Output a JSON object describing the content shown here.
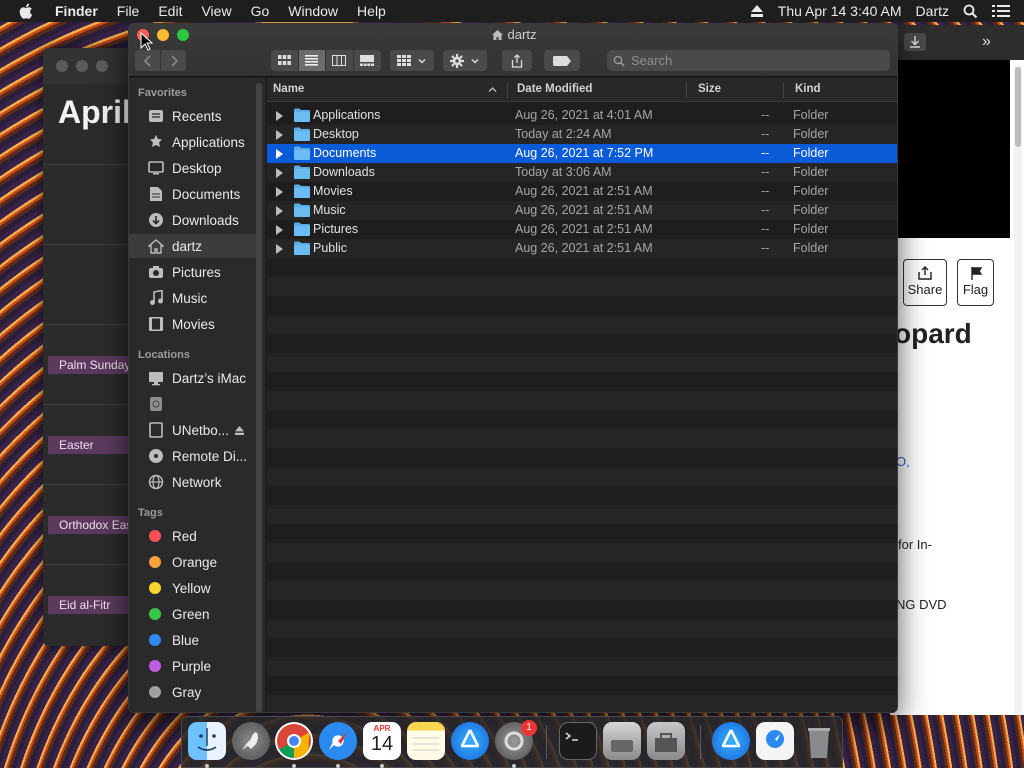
{
  "menubar": {
    "app_name": "Finder",
    "menus": [
      "File",
      "Edit",
      "View",
      "Go",
      "Window",
      "Help"
    ],
    "clock": "Thu Apr 14  3:40 AM",
    "user": "Dartz"
  },
  "calendar": {
    "month": "April",
    "events": [
      "Palm Sunday",
      "Easter",
      "Orthodox Easter",
      "Eid al-Fitr"
    ]
  },
  "safari": {
    "share_label": "Share",
    "flag_label": "Flag",
    "heading_fragment": "opard",
    "text_lines": [
      "O,",
      "for In-",
      "NG DVD"
    ]
  },
  "finder": {
    "title": "dartz",
    "search_placeholder": "Search",
    "sidebar": {
      "favorites_header": "Favorites",
      "favorites": [
        {
          "label": "Recents",
          "icon": "clock-icon"
        },
        {
          "label": "Applications",
          "icon": "applications-icon"
        },
        {
          "label": "Desktop",
          "icon": "desktop-icon"
        },
        {
          "label": "Documents",
          "icon": "document-icon"
        },
        {
          "label": "Downloads",
          "icon": "download-icon"
        },
        {
          "label": "dartz",
          "icon": "home-icon"
        },
        {
          "label": "Pictures",
          "icon": "camera-icon"
        },
        {
          "label": "Music",
          "icon": "music-icon"
        },
        {
          "label": "Movies",
          "icon": "film-icon"
        }
      ],
      "locations_header": "Locations",
      "locations": [
        {
          "label": "Dartz’s iMac",
          "icon": "imac-icon"
        },
        {
          "label": "",
          "icon": "disk-image-icon"
        },
        {
          "label": "UNetbo...",
          "icon": "drive-icon"
        },
        {
          "label": "Remote Di...",
          "icon": "optical-disc-icon"
        },
        {
          "label": "Network",
          "icon": "network-icon"
        }
      ],
      "tags_header": "Tags",
      "tags": [
        {
          "label": "Red",
          "color": "#ff5257"
        },
        {
          "label": "Orange",
          "color": "#f7a13a"
        },
        {
          "label": "Yellow",
          "color": "#f8d52f"
        },
        {
          "label": "Green",
          "color": "#37c747"
        },
        {
          "label": "Blue",
          "color": "#2f89f5"
        },
        {
          "label": "Purple",
          "color": "#c05ee0"
        },
        {
          "label": "Gray",
          "color": "#a0a0a0"
        }
      ]
    },
    "columns": {
      "name": "Name",
      "date": "Date Modified",
      "size": "Size",
      "kind": "Kind"
    },
    "rows": [
      {
        "name": "Applications",
        "date": "Aug 26, 2021 at 4:01 AM",
        "size": "--",
        "kind": "Folder",
        "selected": false
      },
      {
        "name": "Desktop",
        "date": "Today at 2:24 AM",
        "size": "--",
        "kind": "Folder",
        "selected": false
      },
      {
        "name": "Documents",
        "date": "Aug 26, 2021 at 7:52 PM",
        "size": "--",
        "kind": "Folder",
        "selected": true
      },
      {
        "name": "Downloads",
        "date": "Today at 3:06 AM",
        "size": "--",
        "kind": "Folder",
        "selected": false
      },
      {
        "name": "Movies",
        "date": "Aug 26, 2021 at 2:51 AM",
        "size": "--",
        "kind": "Folder",
        "selected": false
      },
      {
        "name": "Music",
        "date": "Aug 26, 2021 at 2:51 AM",
        "size": "--",
        "kind": "Folder",
        "selected": false
      },
      {
        "name": "Pictures",
        "date": "Aug 26, 2021 at 2:51 AM",
        "size": "--",
        "kind": "Folder",
        "selected": false
      },
      {
        "name": "Public",
        "date": "Aug 26, 2021 at 2:51 AM",
        "size": "--",
        "kind": "Folder",
        "selected": false
      }
    ]
  },
  "dock": {
    "apps": [
      "finder-icon",
      "launchpad-icon",
      "chrome-icon",
      "safari-icon",
      "calendar-icon",
      "notes-icon",
      "app-store-icon",
      "system-preferences-icon",
      "terminal-icon",
      "disk-utility-icon",
      "utility-icon",
      "app-store-folder-icon",
      "document-icon",
      "trash-icon"
    ],
    "calendar_month": "APR",
    "calendar_day": "14",
    "prefs_badge": "1"
  }
}
